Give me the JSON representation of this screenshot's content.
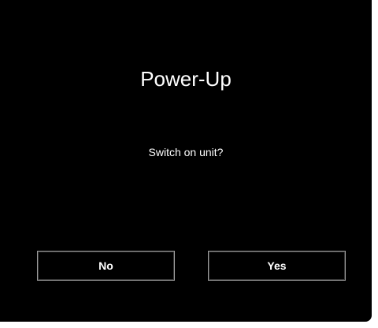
{
  "dialog": {
    "title": "Power-Up",
    "message": "Switch on unit?",
    "buttons": {
      "no_label": "No",
      "yes_label": "Yes"
    }
  },
  "colors": {
    "background": "#000000",
    "text": "#ffffff",
    "button_border": "#9a9a9a"
  }
}
